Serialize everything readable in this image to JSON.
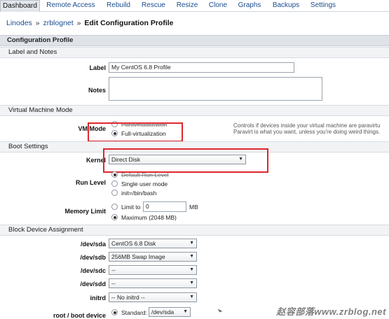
{
  "tabs": [
    {
      "label": "Dashboard",
      "active": true
    },
    {
      "label": "Remote Access"
    },
    {
      "label": "Rebuild"
    },
    {
      "label": "Rescue"
    },
    {
      "label": "Resize"
    },
    {
      "label": "Clone"
    },
    {
      "label": "Graphs"
    },
    {
      "label": "Backups"
    },
    {
      "label": "Settings"
    }
  ],
  "breadcrumb": {
    "linodes": "Linodes",
    "sep": "»",
    "host": "zrblognet",
    "current": "Edit Configuration Profile"
  },
  "sections": {
    "config_profile": "Configuration Profile",
    "label_notes": "Label and Notes",
    "vm_mode": "Virtual Machine Mode",
    "boot": "Boot Settings",
    "block": "Block Device Assignment"
  },
  "labels": {
    "label": "Label",
    "notes": "Notes",
    "vm_mode": "VM Mode",
    "kernel": "Kernel",
    "run_level": "Run Level",
    "memory_limit": "Memory Limit",
    "sda": "/dev/sda",
    "sdb": "/dev/sdb",
    "sdc": "/dev/sdc",
    "sdd": "/dev/sdd",
    "initrd": "initrd",
    "root_boot": "root / boot device"
  },
  "fields": {
    "label_value": "My CentOS 6.8 Profile",
    "kernel_value": "Direct Disk",
    "memory_value": "0",
    "memory_unit": "MB",
    "sda_value": "CentOS 6.8 Disk",
    "sdb_value": "256MB Swap Image",
    "sdc_value": "--",
    "sdd_value": "--",
    "initrd_value": "-- No initrd --",
    "root_value": "/dev/sda"
  },
  "vm_mode": {
    "paravirt": "Paravirtualization",
    "fullvirt": "Full-virtualization",
    "note_line1": "Controls if devices inside your virtual machine are paravirtu",
    "note_line2": "Paravirt is what you want, unless you're doing weird things."
  },
  "run_level": {
    "default": "Default Run Level",
    "single": "Single user mode",
    "init": "init=/bin/bash"
  },
  "memory": {
    "limit_to": "Limit to",
    "maximum": "Maximum (2048 MB)"
  },
  "root": {
    "standard": "Standard:"
  },
  "watermark": "赵容部落www.zrblog.net",
  "colors": {
    "highlight": "#e0262e",
    "link": "#1a4d8f"
  }
}
